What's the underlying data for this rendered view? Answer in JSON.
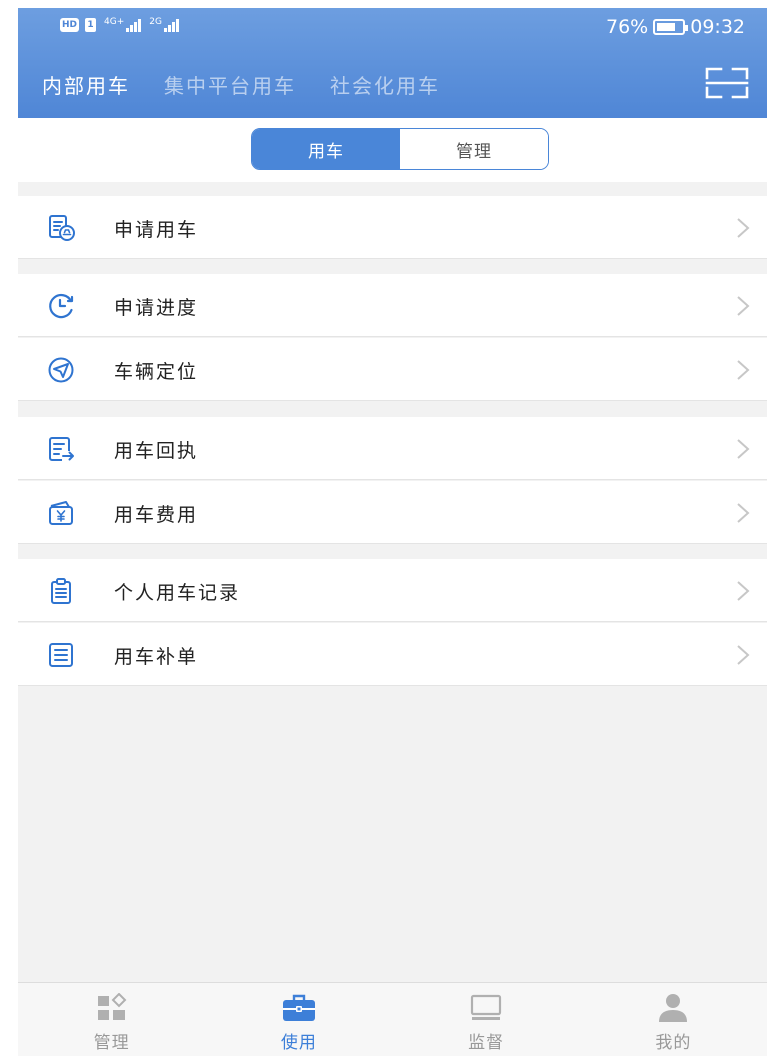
{
  "status_bar": {
    "left_badges": [
      "HD",
      "1"
    ],
    "network_1": "4G+",
    "network_2": "2G",
    "battery_percent": "76%",
    "battery_level": 0.76,
    "time": "09:32"
  },
  "top_tabs": [
    {
      "label": "内部用车",
      "active": true
    },
    {
      "label": "集中平台用车",
      "active": false
    },
    {
      "label": "社会化用车",
      "active": false
    }
  ],
  "segment": {
    "left": "用车",
    "right": "管理",
    "selected": "用车"
  },
  "menu": {
    "group1": [
      {
        "label": "申请用车",
        "icon": "document-car-icon"
      }
    ],
    "group2": [
      {
        "label": "申请进度",
        "icon": "progress-clock-icon"
      },
      {
        "label": "车辆定位",
        "icon": "location-arrow-icon"
      }
    ],
    "group3": [
      {
        "label": "用车回执",
        "icon": "receipt-arrow-icon"
      },
      {
        "label": "用车费用",
        "icon": "wallet-yen-icon"
      }
    ],
    "group4": [
      {
        "label": "个人用车记录",
        "icon": "clipboard-icon"
      },
      {
        "label": "用车补单",
        "icon": "note-icon"
      }
    ]
  },
  "bottom_nav": [
    {
      "label": "管理",
      "icon": "dashboard-icon",
      "active": false
    },
    {
      "label": "使用",
      "icon": "briefcase-icon",
      "active": true
    },
    {
      "label": "监督",
      "icon": "monitor-icon",
      "active": false
    },
    {
      "label": "我的",
      "icon": "user-icon",
      "active": false
    }
  ],
  "colors": {
    "header_start": "#6d9ee0",
    "header_end": "#4f86d6",
    "accent": "#4a86d8",
    "page_background": "#f2f2f2",
    "inactive_nav": "#999999"
  }
}
